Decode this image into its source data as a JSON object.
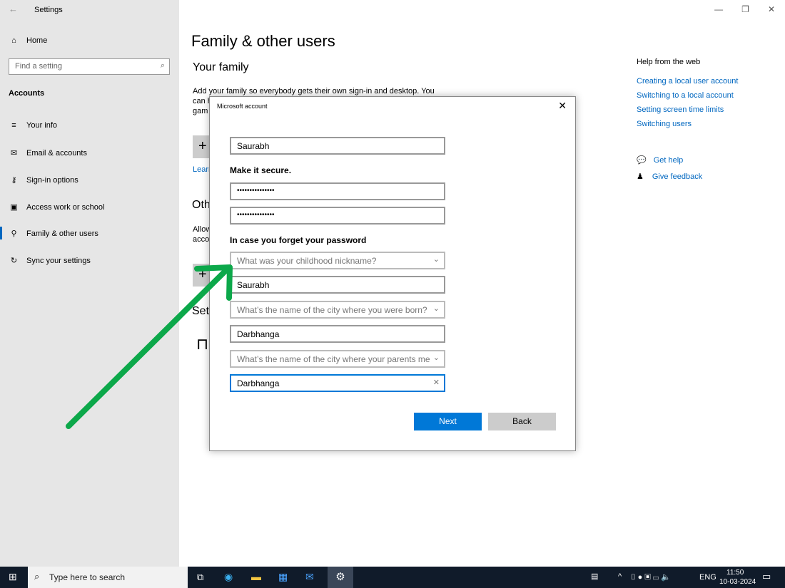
{
  "window": {
    "title": "Settings",
    "controls": [
      "—",
      "❐",
      "✕"
    ]
  },
  "sidebar": {
    "home": "Home",
    "search_placeholder": "Find a setting",
    "section": "Accounts",
    "items": [
      {
        "label": "Your info",
        "icon": "person-list-icon"
      },
      {
        "label": "Email & accounts",
        "icon": "mail-icon"
      },
      {
        "label": "Sign-in options",
        "icon": "key-icon"
      },
      {
        "label": "Access work or school",
        "icon": "briefcase-icon"
      },
      {
        "label": "Family & other users",
        "icon": "person-add-icon"
      },
      {
        "label": "Sync your settings",
        "icon": "sync-icon"
      }
    ]
  },
  "main": {
    "title": "Family & other users",
    "your_family": "Your family",
    "family_desc": "Add your family so everybody gets their own sign-in and desktop. You",
    "family_desc2": "can h",
    "family_desc3": "gam",
    "learn": "Learn",
    "other": "Oth",
    "allow": "Allow",
    "acco": "acco",
    "set": "Set"
  },
  "help": {
    "title": "Help from the web",
    "links": [
      "Creating a local user account",
      "Switching to a local account",
      "Setting screen time limits",
      "Switching users"
    ],
    "get_help": "Get help",
    "feedback": "Give feedback"
  },
  "dialog": {
    "title": "Microsoft account",
    "username": "Saurabh",
    "secure_label": "Make it secure.",
    "password": "•••••••••••••••",
    "confirm": "•••••••••••••••",
    "forget_label": "In case you forget your password",
    "q1": "What was your childhood nickname?",
    "a1": "Saurabh",
    "q2": "What’s the name of the city where you were born?",
    "a2": "Darbhanga",
    "q3": "What’s the name of the city where your parents me",
    "a3": "Darbhanga",
    "next": "Next",
    "back": "Back"
  },
  "taskbar": {
    "search": "Type here to search",
    "lang": "ENG",
    "time": "11:50",
    "date": "10-03-2024"
  },
  "colors": {
    "accent": "#0078d7",
    "arrow": "#0ca84a"
  }
}
